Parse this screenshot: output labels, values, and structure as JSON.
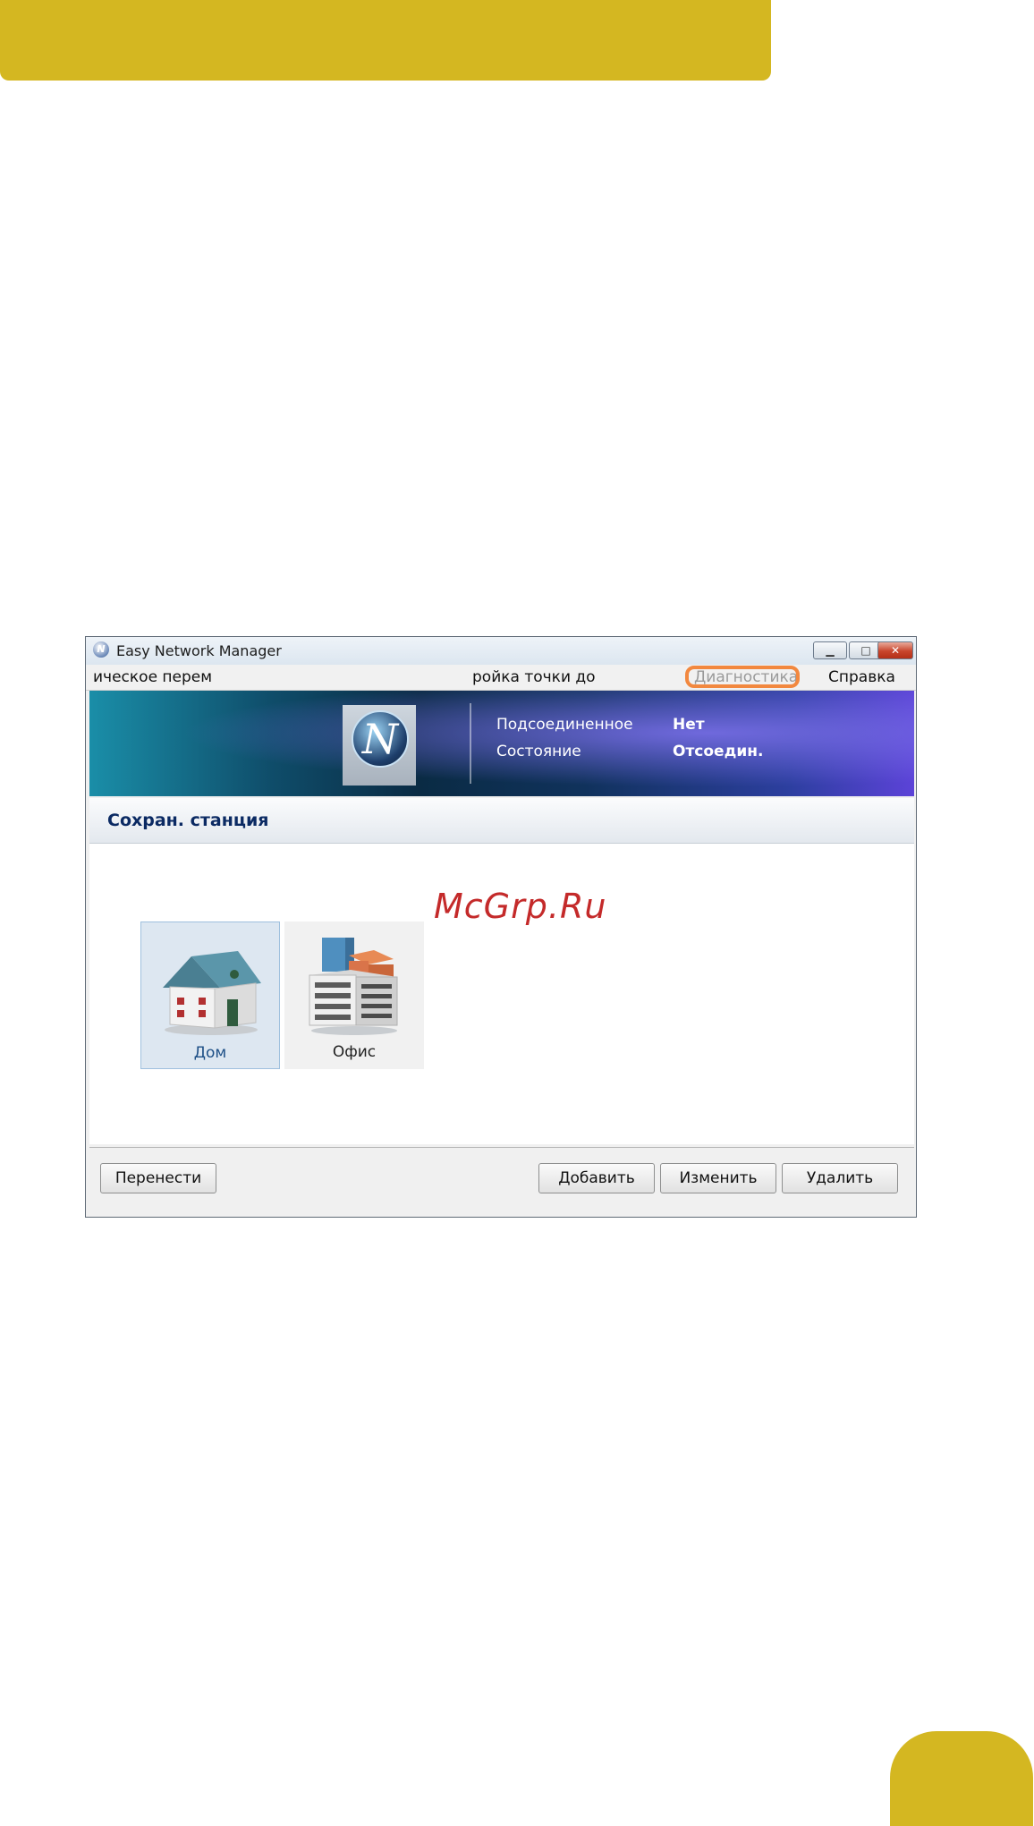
{
  "window": {
    "title": "Easy Network Manager",
    "minimize_glyph": "▁",
    "maximize_glyph": "□",
    "close_glyph": "✕"
  },
  "menu": {
    "items": [
      "ическое перем",
      "ройка точки до",
      "Диагностика",
      "Справка"
    ]
  },
  "logo": {
    "letter": "N"
  },
  "status": {
    "connected_label": "Подсоединенное",
    "connected_value": "Нет",
    "state_label": "Состояние",
    "state_value": "Отсоедин."
  },
  "section": {
    "title": "Сохран. станция"
  },
  "watermark": "McGrp.Ru",
  "profiles": [
    {
      "name": "Дом",
      "icon": "house-icon",
      "selected": true
    },
    {
      "name": "Офис",
      "icon": "office-building-icon",
      "selected": false
    }
  ],
  "buttons": {
    "move": "Перенести",
    "add": "Добавить",
    "edit": "Изменить",
    "delete": "Удалить"
  },
  "colors": {
    "accent_gold": "#d4b721",
    "highlight_orange": "#f2883f",
    "section_title": "#0b2a63"
  }
}
